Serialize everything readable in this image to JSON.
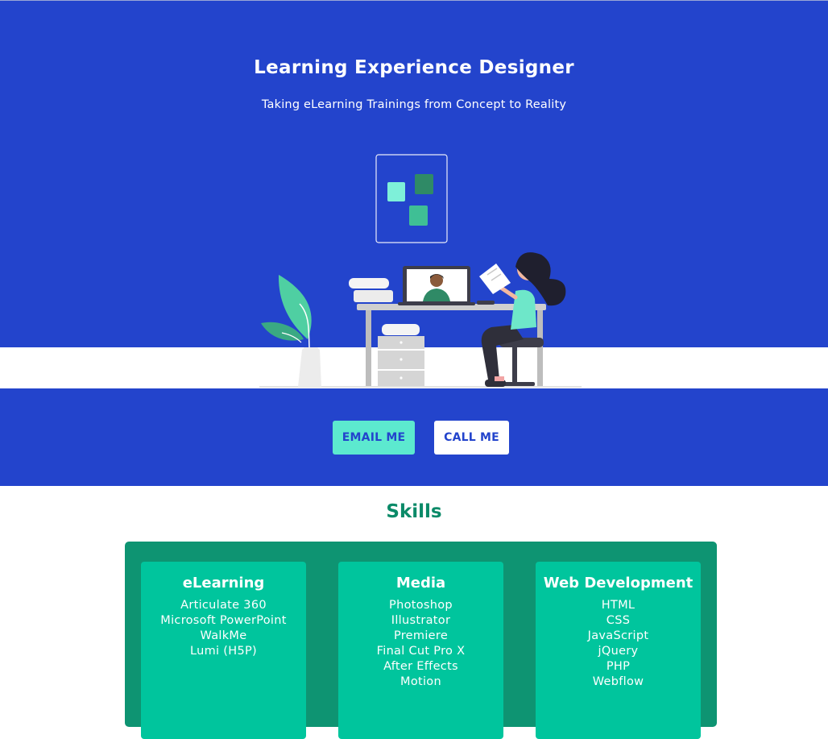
{
  "hero": {
    "title": "Learning Experience Designer",
    "subtitle": "Taking eLearning Trainings from Concept to Reality",
    "background_color": "#2344cc"
  },
  "buttons": {
    "email_label": "EMAIL ME",
    "call_label": "CALL ME"
  },
  "skills": {
    "title": "Skills",
    "categories": [
      {
        "name": "eLearning",
        "items": [
          "Articulate 360",
          "Microsoft PowerPoint",
          "WalkMe",
          "Lumi (H5P)"
        ]
      },
      {
        "name": "Media",
        "items": [
          "Photoshop",
          "Illustrator",
          "Premiere",
          "Final Cut Pro X",
          "After Effects",
          "Motion"
        ]
      },
      {
        "name": "Web Development",
        "items": [
          "HTML",
          "CSS",
          "JavaScript",
          "jQuery",
          "PHP",
          "Webflow"
        ]
      }
    ]
  },
  "colors": {
    "brand_blue": "#2344cc",
    "accent_mint": "#5ce9cf",
    "skills_green": "#0b8a68",
    "card_green": "#00c59d"
  }
}
